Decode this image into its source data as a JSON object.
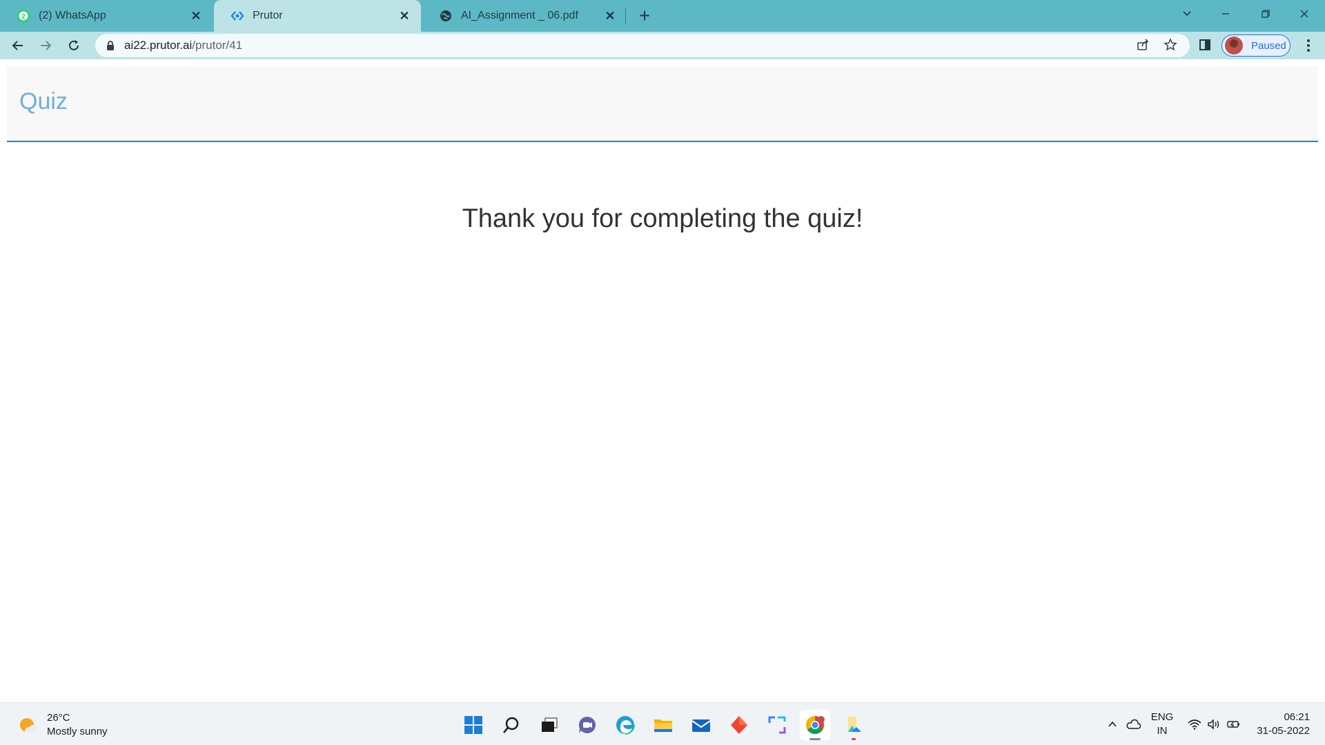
{
  "browser": {
    "tabs": [
      {
        "title": "(2) WhatsApp",
        "favicon": "whatsapp-icon",
        "badge": "2",
        "active": false
      },
      {
        "title": "Prutor",
        "favicon": "prutor-icon",
        "active": true
      },
      {
        "title": "AI_Assignment _ 06.pdf",
        "favicon": "globe-icon",
        "active": false
      }
    ],
    "url": {
      "host": "ai22.prutor.ai",
      "path": "/prutor/41"
    },
    "profile_status": "Paused"
  },
  "page": {
    "header_title": "Quiz",
    "message": "Thank you for completing the quiz!"
  },
  "taskbar": {
    "weather": {
      "temperature": "26°C",
      "condition": "Mostly sunny"
    },
    "apps": [
      "start-icon",
      "search-icon",
      "task-view-icon",
      "chat-icon",
      "edge-icon",
      "file-explorer-icon",
      "mail-icon",
      "office-icon",
      "snipping-tool-icon",
      "chrome-icon",
      "photos-icon"
    ],
    "language": {
      "line1": "ENG",
      "line2": "IN"
    },
    "time": "06:21",
    "date": "31-05-2022"
  },
  "colors": {
    "tabstrip": "#5cb8c4",
    "toolbar": "#bde3e7",
    "quiz_title": "#6eaee0",
    "header_rule": "#3b7ea1"
  }
}
